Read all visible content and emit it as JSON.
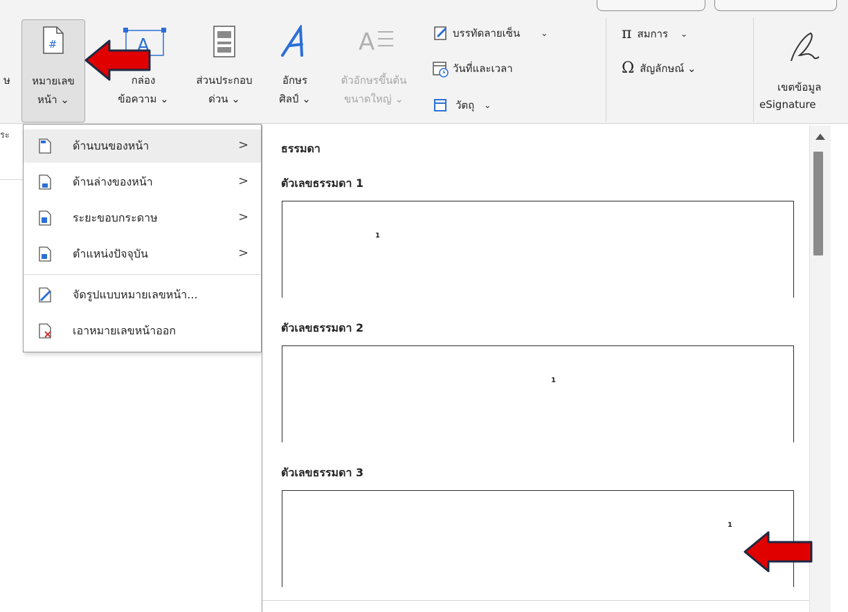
{
  "ribbon": {
    "partial_left_label": "ษ",
    "page_number": {
      "line1": "หมายเลข",
      "line2": "หน้า ⌄"
    },
    "text_box": {
      "line1": "กล่อง",
      "line2": "ข้อความ ⌄"
    },
    "quick_parts": {
      "line1": "ส่วนประกอบ",
      "line2": "ด่วน ⌄"
    },
    "wordart": {
      "line1": "อักษร",
      "line2": "ศิลป์ ⌄"
    },
    "drop_cap": {
      "line1": "ตัวอักษรขึ้นต้น",
      "line2": "ขนาดใหญ่ ⌄"
    },
    "signature_line": "บรรทัดลายเซ็น",
    "date_time": "วันที่และเวลา",
    "object": "วัตถุ",
    "equation": "สมการ",
    "symbol": "สัญลักษณ์ ⌄",
    "esignature": {
      "line1": "เขตข้อมูล",
      "line2": "eSignature"
    },
    "group_partial_left": "ระ",
    "group_partial_right": "e"
  },
  "menu": {
    "items": [
      {
        "label": "ด้านบนของหน้า",
        "has_submenu": true,
        "icon": "page-top-icon"
      },
      {
        "label": "ด้านล่างของหน้า",
        "has_submenu": true,
        "icon": "page-bottom-icon"
      },
      {
        "label": "ระยะขอบกระดาษ",
        "has_submenu": true,
        "icon": "page-margin-icon"
      },
      {
        "label": "ตำแหน่งปัจจุบัน",
        "has_submenu": true,
        "icon": "current-position-icon"
      },
      {
        "label": "จัดรูปแบบหมายเลขหน้า...",
        "has_submenu": false,
        "icon": "format-page-number-icon"
      },
      {
        "label": "เอาหมายเลขหน้าออก",
        "has_submenu": false,
        "icon": "remove-page-number-icon"
      }
    ],
    "submenu_arrow": ">"
  },
  "gallery": {
    "category": "ธรรมดา",
    "options": [
      {
        "title": "ตัวเลขธรรมดา 1",
        "number": "1"
      },
      {
        "title": "ตัวเลขธรรมดา 2",
        "number": "1"
      },
      {
        "title": "ตัวเลขธรรมดา 3",
        "number": "1"
      }
    ]
  },
  "colors": {
    "annotation_arrow": "#e00000",
    "arrow_outline": "#1c2a44",
    "accent_blue": "#2b6fd6"
  }
}
